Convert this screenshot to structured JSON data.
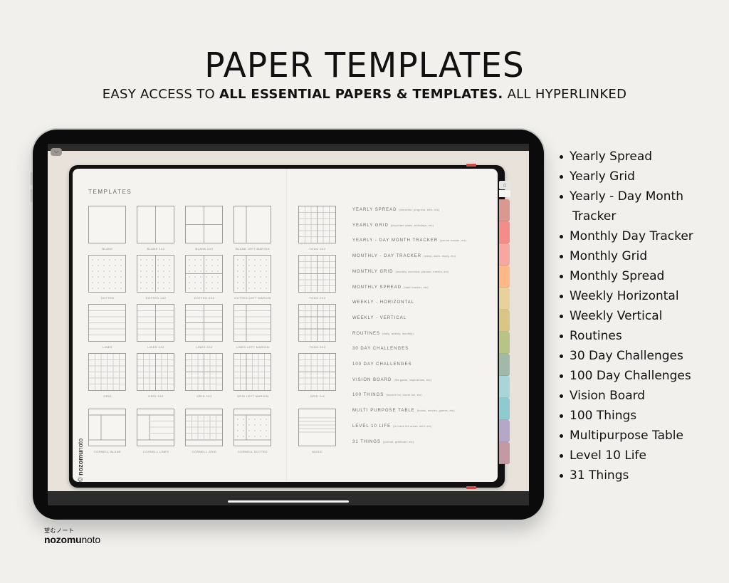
{
  "header": {
    "title": "PAPER TEMPLATES",
    "subtitle_prefix": "EASY ACCESS TO ",
    "subtitle_bold": "ALL ESSENTIAL PAPERS & TEMPLATES.",
    "subtitle_suffix": " ALL HYPERLINKED"
  },
  "planner": {
    "page_title": "TEMPLATES",
    "copyright_symbol": "©",
    "copyright_bold": "nozomu",
    "copyright_rest": "noto",
    "collapse_icon": "chevron-down-icon",
    "home_icon": "home-icon",
    "templates": [
      {
        "label": "BLANK",
        "type": "blank"
      },
      {
        "label": "BLANK 1X2",
        "type": "blank-1x2"
      },
      {
        "label": "BLANK 2X2",
        "type": "blank-2x2"
      },
      {
        "label": "BLANK LEFT MARGIN",
        "type": "blank-left"
      },
      {
        "label": "DOTTED",
        "type": "dotted"
      },
      {
        "label": "DOTTED 1X2",
        "type": "dotted-1x2"
      },
      {
        "label": "DOTTED 2X2",
        "type": "dotted-2x2"
      },
      {
        "label": "DOTTED LEFT MARGIN",
        "type": "dotted-left"
      },
      {
        "label": "LINES",
        "type": "lines"
      },
      {
        "label": "LINES 1X2",
        "type": "lines-1x2"
      },
      {
        "label": "LINES 2X2",
        "type": "lines-2x2"
      },
      {
        "label": "LINES LEFT MARGIN",
        "type": "lines-left"
      },
      {
        "label": "GRID",
        "type": "grid"
      },
      {
        "label": "GRID 1X2",
        "type": "grid-1x2"
      },
      {
        "label": "GRID 2X2",
        "type": "grid-2x2"
      },
      {
        "label": "GRID LEFT MARGIN",
        "type": "grid-left"
      },
      {
        "label": "CORNELL BLANK",
        "type": "cornell-blank"
      },
      {
        "label": "CORNELL LINES",
        "type": "cornell-lines"
      },
      {
        "label": "CORNELL GRID",
        "type": "cornell-grid"
      },
      {
        "label": "CORNELL DOTTED",
        "type": "cornell-dotted"
      }
    ],
    "todo_templates": [
      {
        "label": "TODO 1X2",
        "type": "todo-1x2"
      },
      {
        "label": "TODO 2X2",
        "type": "todo-2x2"
      },
      {
        "label": "TODO 3X2",
        "type": "todo-3x2"
      },
      {
        "label": "GRID 2x1",
        "type": "grid-2x1"
      },
      {
        "label": "MUSIC",
        "type": "music"
      }
    ],
    "links": [
      {
        "title": "YEARLY SPREAD",
        "note": "(checklist, progress, bills, etc)"
      },
      {
        "title": "YEARLY GRID",
        "note": "(important dates, birthdays, etc)"
      },
      {
        "title": "YEARLY - DAY MONTH TRACKER",
        "note": "(period tracker, etc)"
      },
      {
        "title": "MONTHLY - DAY TRACKER",
        "note": "(sleep, work, study, etc)"
      },
      {
        "title": "MONTHLY GRID",
        "note": "(monthly overview, planner, events, etc)"
      },
      {
        "title": "MONTHLY SPREAD",
        "note": "(habit tracker, etc)"
      },
      {
        "title": "WEEKLY - HORIZONTAL",
        "note": ""
      },
      {
        "title": "WEEKLY - VERTICAL",
        "note": ""
      },
      {
        "title": "ROUTINES",
        "note": "(daily, weekly, monthly)"
      },
      {
        "title": "30 DAY CHALLENGES",
        "note": ""
      },
      {
        "title": "100 DAY CHALLENGES",
        "note": ""
      },
      {
        "title": "VISION BOARD",
        "note": "(life goals, inspirations, etc)"
      },
      {
        "title": "100 THINGS",
        "note": "(bucket list, travel list, etc)"
      },
      {
        "title": "MULTI PURPOSE TABLE",
        "note": "(books, movies, games, etc)"
      },
      {
        "title": "LEVEL 10 LIFE",
        "note": "(to track life areas, skill, etc)"
      },
      {
        "title": "31 THINGS",
        "note": "(journal, gratitude, etc)"
      }
    ],
    "tab_colors": [
      "#d99890",
      "#f48c88",
      "#f7a7a0",
      "#fcb985",
      "#e8d19b",
      "#d9c586",
      "#b8c486",
      "#a2b9a8",
      "#a7d6d8",
      "#8ecbd0",
      "#b5a8c6",
      "#c39aa3"
    ]
  },
  "features": [
    "Yearly Spread",
    "Yearly Grid",
    "Yearly - Day Month",
    "Tracker",
    "Monthly Day Tracker",
    "Monthly Grid",
    "Monthly Spread",
    "Weekly Horizontal",
    "Weekly Vertical",
    "Routines",
    "30 Day Challenges",
    "100 Day Challenges",
    "Vision Board",
    "100 Things",
    "Multipurpose Table",
    "Level 10 Life",
    "31 Things"
  ],
  "brand": {
    "japanese": "望むノート",
    "name_bold": "nozomu",
    "name_rest": "noto"
  }
}
